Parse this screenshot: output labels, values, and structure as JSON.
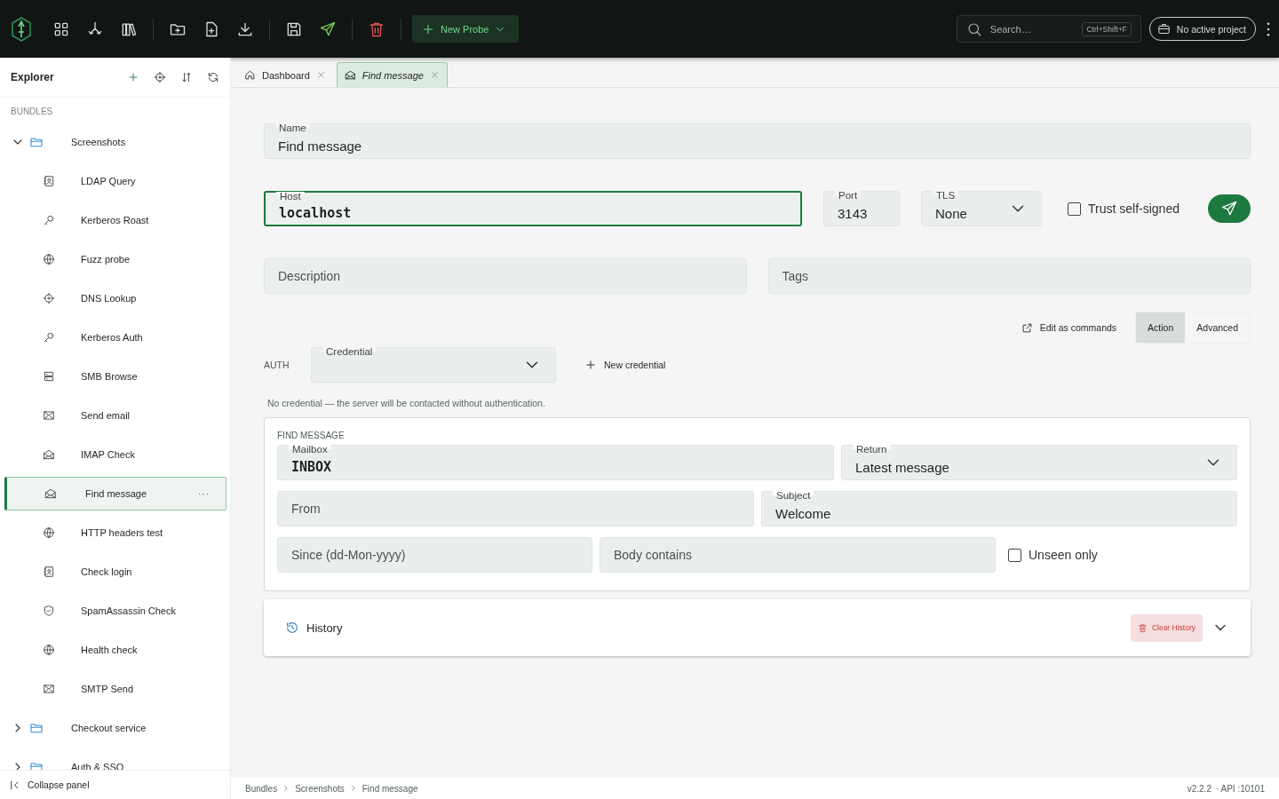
{
  "topbar": {
    "new_probe": "New Probe",
    "search": {
      "placeholder": "Search…",
      "shortcut": "Ctrl+Shift+F"
    },
    "project": "No active project"
  },
  "sidebar": {
    "title": "Explorer",
    "section": "BUNDLES",
    "collapse": "Collapse panel",
    "tree": [
      {
        "label": "Screenshots",
        "expanded": true,
        "children": [
          {
            "label": "LDAP Query",
            "kind": "contact",
            "selected": false
          },
          {
            "label": "Kerberos Roast",
            "kind": "key",
            "selected": false
          },
          {
            "label": "Fuzz probe",
            "kind": "globe",
            "selected": false
          },
          {
            "label": "DNS Lookup",
            "kind": "target",
            "selected": false
          },
          {
            "label": "Kerberos Auth",
            "kind": "key",
            "selected": false
          },
          {
            "label": "SMB Browse",
            "kind": "server",
            "selected": false
          },
          {
            "label": "Send email",
            "kind": "mail",
            "selected": false
          },
          {
            "label": "IMAP Check",
            "kind": "mail-open",
            "selected": false
          },
          {
            "label": "Find message",
            "kind": "mail-open",
            "selected": true,
            "menu": "···"
          },
          {
            "label": "HTTP headers test",
            "kind": "globe",
            "selected": false
          },
          {
            "label": "Check login",
            "kind": "contact",
            "selected": false
          },
          {
            "label": "SpamAssassin Check",
            "kind": "shield",
            "selected": false
          },
          {
            "label": "Health check",
            "kind": "globe",
            "selected": false
          },
          {
            "label": "SMTP Send",
            "kind": "mail",
            "selected": false
          }
        ]
      },
      {
        "label": "Checkout service",
        "expanded": false
      },
      {
        "label": "Auth & SSO",
        "expanded": false
      }
    ]
  },
  "tabs": [
    {
      "label": "Dashboard",
      "kind": "home",
      "selected": false
    },
    {
      "label": "Find message",
      "kind": "mail-open",
      "selected": true
    }
  ],
  "form": {
    "name": {
      "label": "Name",
      "value": "Find message"
    },
    "host": {
      "label": "Host",
      "value": "localhost",
      "focused": true
    },
    "port": {
      "label": "Port",
      "value": "3143"
    },
    "tls": {
      "label": "TLS",
      "value": "None"
    },
    "trust": {
      "label": "Trust self-signed",
      "checked": false
    },
    "description": {
      "placeholder": "Description"
    },
    "tags": {
      "placeholder": "Tags"
    },
    "edit_commands": "Edit as commands",
    "modes": [
      {
        "label": "Action",
        "selected": true
      },
      {
        "label": "Advanced",
        "selected": false
      }
    ],
    "auth": {
      "label": "AUTH",
      "credential": {
        "label": "Credential"
      },
      "new_credential": "New credential",
      "note": "No credential — the server will be contacted without authentication."
    },
    "find": {
      "title": "FIND MESSAGE",
      "mailbox": {
        "label": "Mailbox",
        "value": "INBOX"
      },
      "return": {
        "label": "Return",
        "value": "Latest message"
      },
      "from": {
        "placeholder": "From"
      },
      "subject": {
        "label": "Subject",
        "value": "Welcome"
      },
      "since": {
        "placeholder": "Since (dd-Mon-yyyy)"
      },
      "body": {
        "placeholder": "Body contains"
      },
      "unseen": {
        "label": "Unseen only",
        "checked": false
      }
    },
    "history": {
      "title": "History",
      "clear": "Clear History",
      "expanded": false
    }
  },
  "status": {
    "breadcrumb": [
      "Bundles",
      "Screenshots",
      "Find message"
    ],
    "version": "v2.2.2",
    "api": "· API :10101"
  }
}
